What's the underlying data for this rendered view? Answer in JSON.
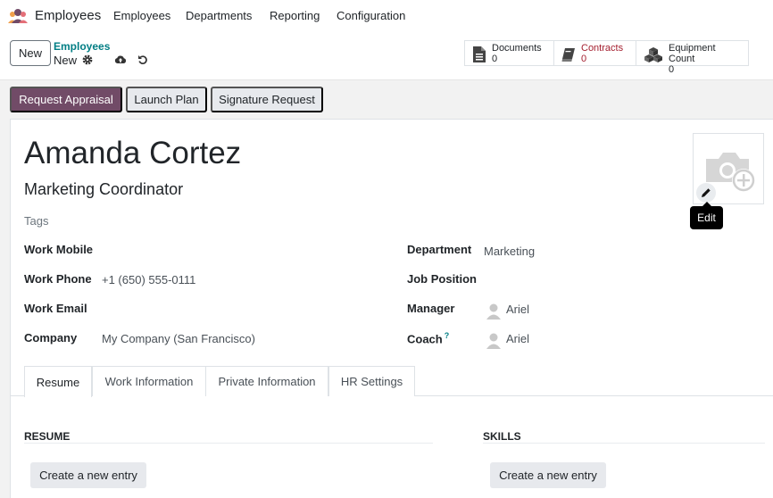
{
  "navbar": {
    "app_name": "Employees",
    "menu": [
      "Employees",
      "Departments",
      "Reporting",
      "Configuration"
    ]
  },
  "control_panel": {
    "new_label": "New",
    "breadcrumb_parent": "Employees",
    "breadcrumb_current": "New",
    "smart_buttons": [
      {
        "label": "Documents",
        "count": "0",
        "icon": "file-icon"
      },
      {
        "label": "Contracts",
        "count": "0",
        "icon": "book-icon"
      },
      {
        "label": "Equipment Count",
        "count": "0",
        "icon": "cubes-icon"
      }
    ]
  },
  "status_bar": {
    "buttons": [
      "Request Appraisal",
      "Launch Plan",
      "Signature Request"
    ]
  },
  "employee": {
    "name": "Amanda Cortez",
    "job_title": "Marketing Coordinator",
    "tags_placeholder": "Tags",
    "edit_tooltip": "Edit"
  },
  "fields_left": [
    {
      "label": "Work Mobile",
      "value": ""
    },
    {
      "label": "Work Phone",
      "value": "+1 (650) 555-0111"
    },
    {
      "label": "Work Email",
      "value": ""
    },
    {
      "label": "Company",
      "value": "My Company (San Francisco)"
    }
  ],
  "fields_right": [
    {
      "label": "Department",
      "value": "Marketing"
    },
    {
      "label": "Job Position",
      "value": ""
    },
    {
      "label": "Manager",
      "value": "Ariel"
    },
    {
      "label": "Coach",
      "value": "Ariel",
      "help": "?"
    }
  ],
  "tabs": [
    "Resume",
    "Work Information",
    "Private Information",
    "HR Settings"
  ],
  "resume": {
    "title": "RESUME",
    "create_label": "Create a new entry"
  },
  "skills": {
    "title": "SKILLS",
    "create_label": "Create a new entry"
  },
  "colors": {
    "primary": "#714b67",
    "teal": "#017e84",
    "contracts_red": "#a41f2f"
  }
}
